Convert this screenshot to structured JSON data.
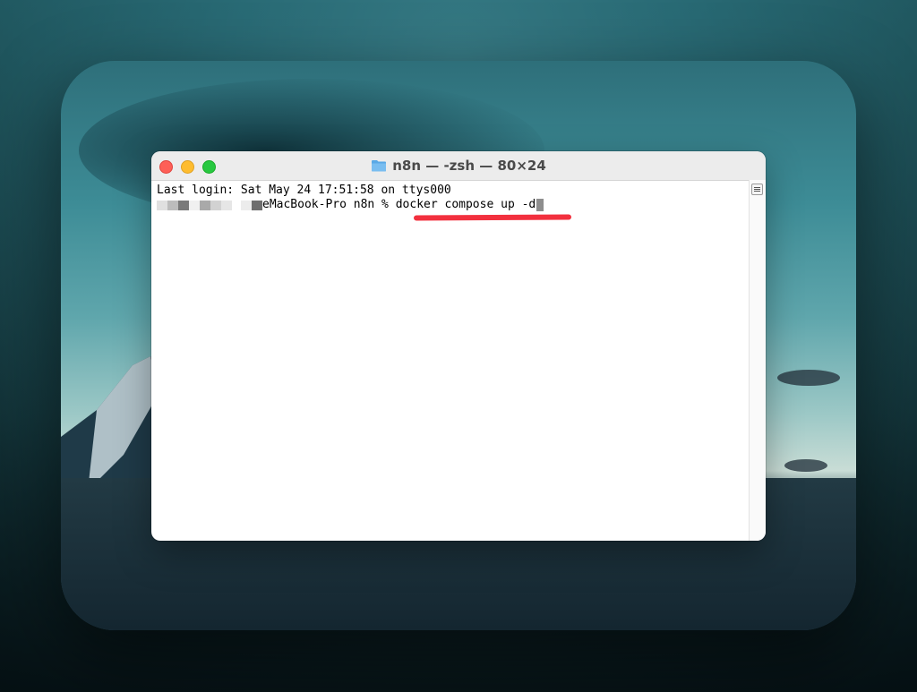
{
  "window": {
    "title": "n8n — -zsh — 80×24",
    "folder_icon": "folder-icon"
  },
  "terminal": {
    "last_login": "Last login: Sat May 24 17:51:58 on ttys000",
    "prompt_host": "eMacBook-Pro n8n % ",
    "command": "docker compose up -d"
  },
  "colors": {
    "highlight_underline": "#f2303e",
    "traffic_close": "#fe5f57",
    "traffic_minimize": "#febc2e",
    "traffic_maximize": "#28c840"
  }
}
